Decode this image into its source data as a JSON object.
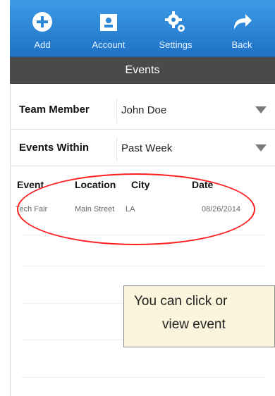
{
  "toolbar": {
    "items": [
      {
        "label": "Add",
        "icon": "plus-circle-icon"
      },
      {
        "label": "Account",
        "icon": "account-card-icon"
      },
      {
        "label": "Settings",
        "icon": "gears-icon"
      },
      {
        "label": "Back",
        "icon": "back-arrow-icon"
      }
    ]
  },
  "page": {
    "title": "Events"
  },
  "filters": {
    "team_member": {
      "label": "Team Member",
      "value": "John Doe"
    },
    "events_within": {
      "label": "Events Within",
      "value": "Past Week"
    }
  },
  "table": {
    "headers": [
      "Event",
      "Location",
      "City",
      "Date"
    ],
    "rows": [
      [
        "Tech Fair",
        "Main Street",
        "LA",
        "08/26/2014"
      ]
    ]
  },
  "callout": {
    "line1": "You can click or",
    "line2": "view event"
  },
  "colors": {
    "toolbar_blue": "#2b86d8",
    "title_bar": "#4a4a4a",
    "annotation_red": "#ff1f1f",
    "callout_bg": "#fbf5dd"
  }
}
